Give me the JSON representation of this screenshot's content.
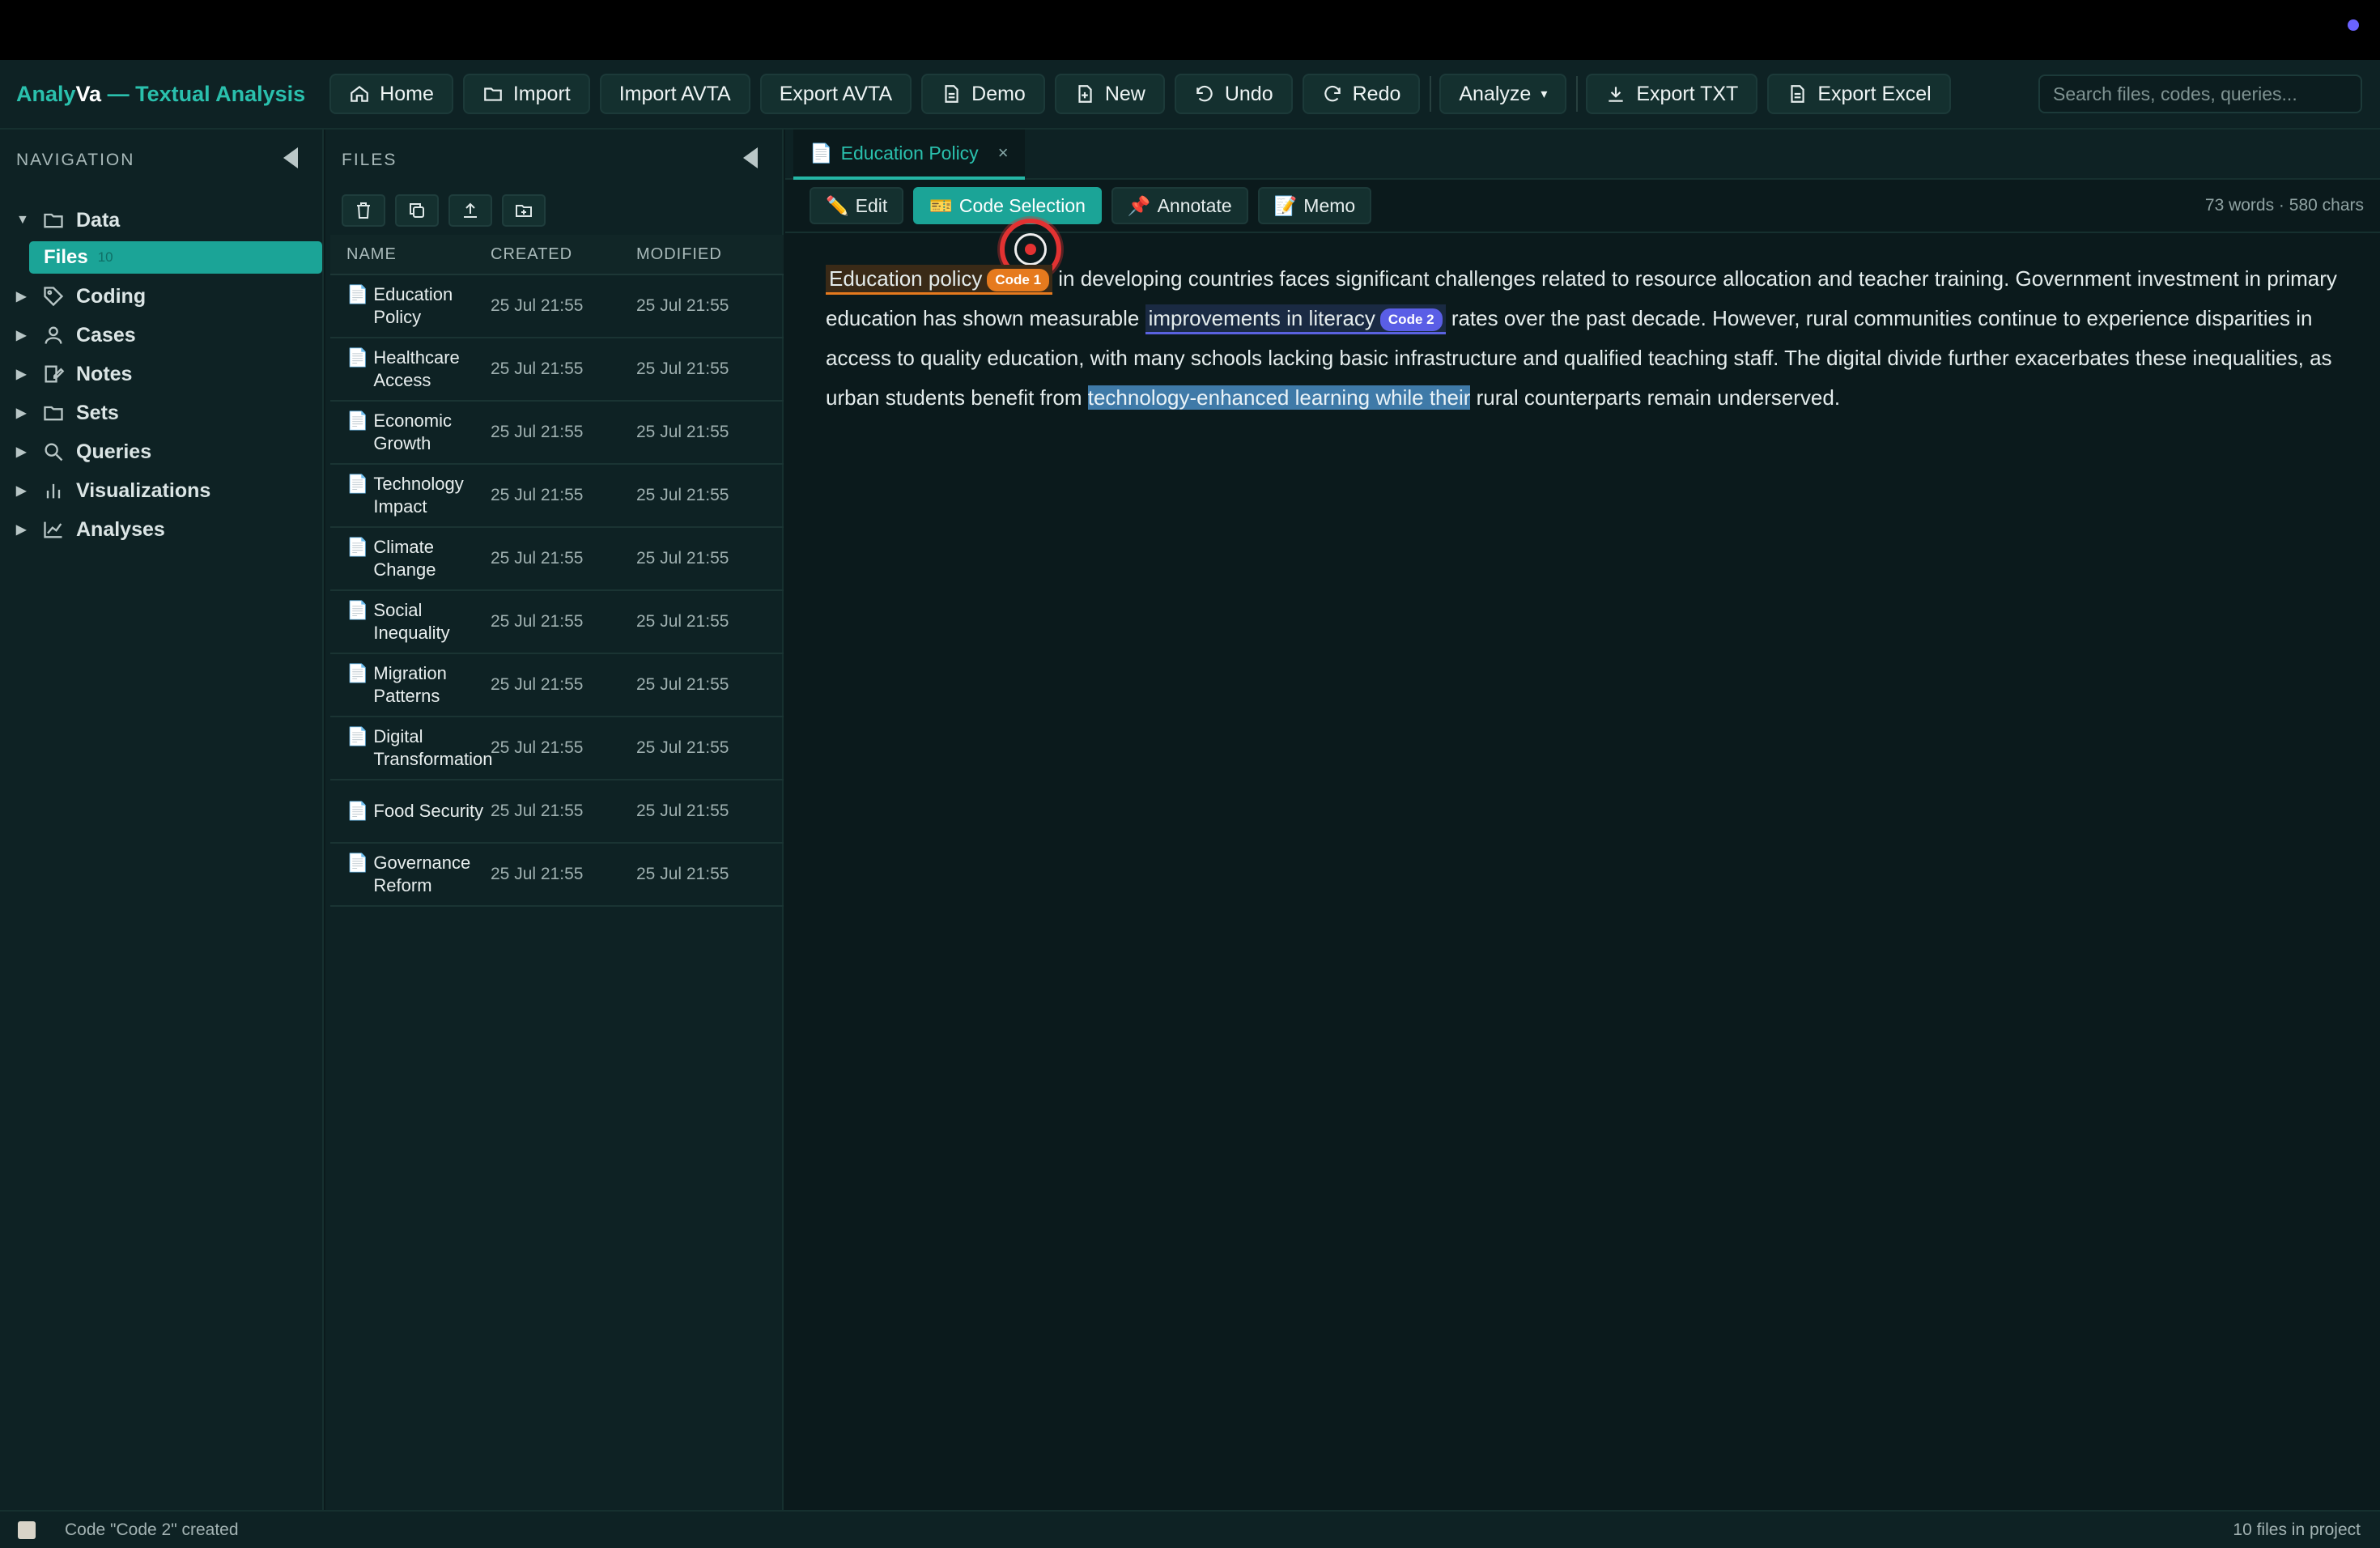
{
  "brand": {
    "part1": "Analy",
    "part2": "Va",
    "suffix": " — Textual Analysis"
  },
  "toolbar": {
    "home": "Home",
    "import": "Import",
    "import_avta": "Import AVTA",
    "export_avta": "Export AVTA",
    "demo": "Demo",
    "new": "New",
    "undo": "Undo",
    "redo": "Redo",
    "analyze": "Analyze",
    "export_txt": "Export TXT",
    "export_excel": "Export Excel"
  },
  "search": {
    "placeholder": "Search files, codes, queries..."
  },
  "nav": {
    "title": "NAVIGATION",
    "items": [
      {
        "label": "Data",
        "icon": "folder-icon",
        "expanded": true
      },
      {
        "label": "Coding",
        "icon": "tag-icon"
      },
      {
        "label": "Cases",
        "icon": "user-icon"
      },
      {
        "label": "Notes",
        "icon": "note-edit-icon"
      },
      {
        "label": "Sets",
        "icon": "folder-icon"
      },
      {
        "label": "Queries",
        "icon": "search-icon"
      },
      {
        "label": "Visualizations",
        "icon": "bar-chart-icon"
      },
      {
        "label": "Analyses",
        "icon": "line-chart-icon"
      }
    ],
    "files_label": "Files",
    "files_count": "10"
  },
  "files": {
    "title": "FILES",
    "headers": {
      "name": "NAME",
      "created": "CREATED",
      "modified": "MODIFIED"
    },
    "rows": [
      {
        "name": "Education Policy",
        "created": "25 Jul 21:55",
        "modified": "25 Jul 21:55"
      },
      {
        "name": "Healthcare Access",
        "created": "25 Jul 21:55",
        "modified": "25 Jul 21:55"
      },
      {
        "name": "Economic Growth",
        "created": "25 Jul 21:55",
        "modified": "25 Jul 21:55"
      },
      {
        "name": "Technology Impact",
        "created": "25 Jul 21:55",
        "modified": "25 Jul 21:55"
      },
      {
        "name": "Climate Change",
        "created": "25 Jul 21:55",
        "modified": "25 Jul 21:55"
      },
      {
        "name": "Social Inequality",
        "created": "25 Jul 21:55",
        "modified": "25 Jul 21:55"
      },
      {
        "name": "Migration Patterns",
        "created": "25 Jul 21:55",
        "modified": "25 Jul 21:55"
      },
      {
        "name": "Digital Transformation",
        "created": "25 Jul 21:55",
        "modified": "25 Jul 21:55"
      },
      {
        "name": "Food Security",
        "created": "25 Jul 21:55",
        "modified": "25 Jul 21:55"
      },
      {
        "name": "Governance Reform",
        "created": "25 Jul 21:55",
        "modified": "25 Jul 21:55"
      }
    ]
  },
  "editor": {
    "tab_label": "Education Policy",
    "modes": {
      "edit": "Edit",
      "code_selection": "Code Selection",
      "annotate": "Annotate",
      "memo": "Memo"
    },
    "stats": "73 words · 580 chars",
    "text": {
      "seg1_coded": "Education policy",
      "code1": "Code 1",
      "seg2": " in developing countries faces significant challenges related to resource allocation and teacher training. Government investment in primary education has shown measurable ",
      "seg3_coded": "improvements in literacy",
      "code2": "Code 2",
      "seg4": " rates over the past decade. However, rural communities continue to experience disparities in access to quality education, with many schools lacking basic infrastructure and qualified teaching staff. The digital divide further exacerbates these inequalities, as urban students benefit from ",
      "seg5_selected": "technology-enhanced learning while their",
      "seg6": " rural counterparts remain underserved."
    }
  },
  "status": {
    "message": "Code \"Code 2\" created",
    "right": "10 files in project"
  },
  "colors": {
    "accent": "#1ba497",
    "code1": "#e67a1e",
    "code2": "#5a5ee6",
    "selection": "#3f7aa8"
  }
}
